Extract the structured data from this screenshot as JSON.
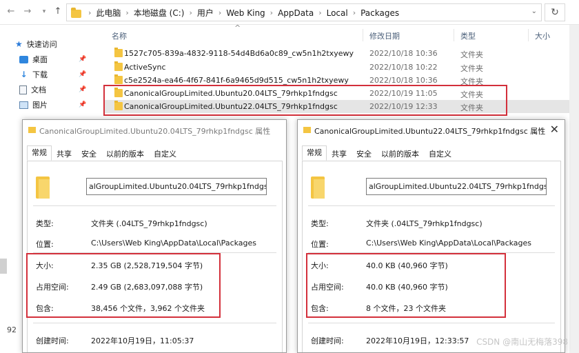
{
  "addressbar": {
    "crumbs": [
      "此电脑",
      "本地磁盘 (C:)",
      "用户",
      "Web King",
      "AppData",
      "Local",
      "Packages"
    ]
  },
  "sidebar": {
    "quick_access": "快速访问",
    "items": [
      {
        "label": "桌面",
        "icon": "desktop-icon"
      },
      {
        "label": "下载",
        "icon": "download-icon"
      },
      {
        "label": "文档",
        "icon": "document-icon"
      },
      {
        "label": "图片",
        "icon": "picture-icon"
      }
    ],
    "count_label": "92"
  },
  "columns": {
    "name": "名称",
    "modified": "修改日期",
    "type": "类型",
    "size": "大小"
  },
  "files": [
    {
      "name": "1527c705-839a-4832-9118-54d4Bd6a0c89_cw5n1h2txyewy",
      "date": "2022/10/18 10:36",
      "type": "文件夹"
    },
    {
      "name": "ActiveSync",
      "date": "2022/10/18 10:22",
      "type": "文件夹"
    },
    {
      "name": "c5e2524a-ea46-4f67-841f-6a9465d9d515_cw5n1h2txyewy",
      "date": "2022/10/18 10:36",
      "type": "文件夹"
    },
    {
      "name": "CanonicalGroupLimited.Ubuntu20.04LTS_79rhkp1fndgsc",
      "date": "2022/10/19 11:05",
      "type": "文件夹"
    },
    {
      "name": "CanonicalGroupLimited.Ubuntu22.04LTS_79rhkp1fndgsc",
      "date": "2022/10/19 12:33",
      "type": "文件夹"
    }
  ],
  "dialog1": {
    "title": "CanonicalGroupLimited.Ubuntu20.04LTS_79rhkp1fndgsc 属性",
    "tabs": [
      "常规",
      "共享",
      "安全",
      "以前的版本",
      "自定义"
    ],
    "name_value": "alGroupLimited.Ubuntu20.04LTS_79rhkp1fndgsc",
    "type_label": "类型:",
    "type_value": "文件夹 (.04LTS_79rhkp1fndgsc)",
    "location_label": "位置:",
    "location_value": "C:\\Users\\Web King\\AppData\\Local\\Packages",
    "size_label": "大小:",
    "size_value": "2.35 GB (2,528,719,504 字节)",
    "disk_label": "占用空间:",
    "disk_value": "2.49 GB (2,683,097,088 字节)",
    "contains_label": "包含:",
    "contains_value": "38,456 个文件，3,962 个文件夹",
    "created_label": "创建时间:",
    "created_value": "2022年10月19日，11:05:37"
  },
  "dialog2": {
    "title": "CanonicalGroupLimited.Ubuntu22.04LTS_79rhkp1fndgsc 属性",
    "tabs": [
      "常规",
      "共享",
      "安全",
      "以前的版本",
      "自定义"
    ],
    "name_value": "alGroupLimited.Ubuntu22.04LTS_79rhkp1fndgsc",
    "type_label": "类型:",
    "type_value": "文件夹 (.04LTS_79rhkp1fndgsc)",
    "location_label": "位置:",
    "location_value": "C:\\Users\\Web King\\AppData\\Local\\Packages",
    "size_label": "大小:",
    "size_value": "40.0 KB (40,960 字节)",
    "disk_label": "占用空间:",
    "disk_value": "40.0 KB (40,960 字节)",
    "contains_label": "包含:",
    "contains_value": "8 个文件，23 个文件夹",
    "created_label": "创建时间:",
    "created_value": "2022年10月19日，12:33:57"
  },
  "watermark": "CSDN @南山无梅落398",
  "accent_red": "#d32f3a",
  "folder_color": "#f4c542"
}
